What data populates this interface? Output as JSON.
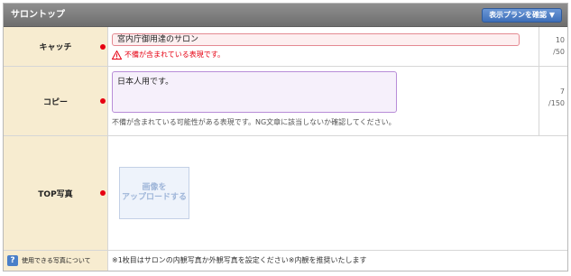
{
  "header": {
    "title": "サロントップ",
    "plan_button_label": "表示プランを確認 ▼"
  },
  "catch": {
    "label": "キャッチ",
    "value": "宮内庁御用達のサロン",
    "warning": "不備が含まれている表現です。",
    "count_current": "10",
    "count_max": "/50"
  },
  "copy": {
    "label": "コピー",
    "value": "日本人用です。",
    "hint": "不備が含まれている可能性がある表現です。NG文章に該当しないか確認してください。",
    "count_current": "7",
    "count_max": "/150"
  },
  "top_photo": {
    "label": "TOP写真",
    "upload_label": "画像を\nアップロードする"
  },
  "footer": {
    "help_icon_text": "?",
    "help_link": "使用できる写真について",
    "note": "※1枚目はサロンの内観写真か外観写真を設定ください※内観を推奨いたします"
  },
  "colors": {
    "header_bg": "#7f7f7f",
    "label_bg": "#f7ecd0",
    "required": "#e60012",
    "accent_button": "#4a7fc8",
    "error_border": "#e48a92",
    "warn_border": "#b88dd8"
  }
}
